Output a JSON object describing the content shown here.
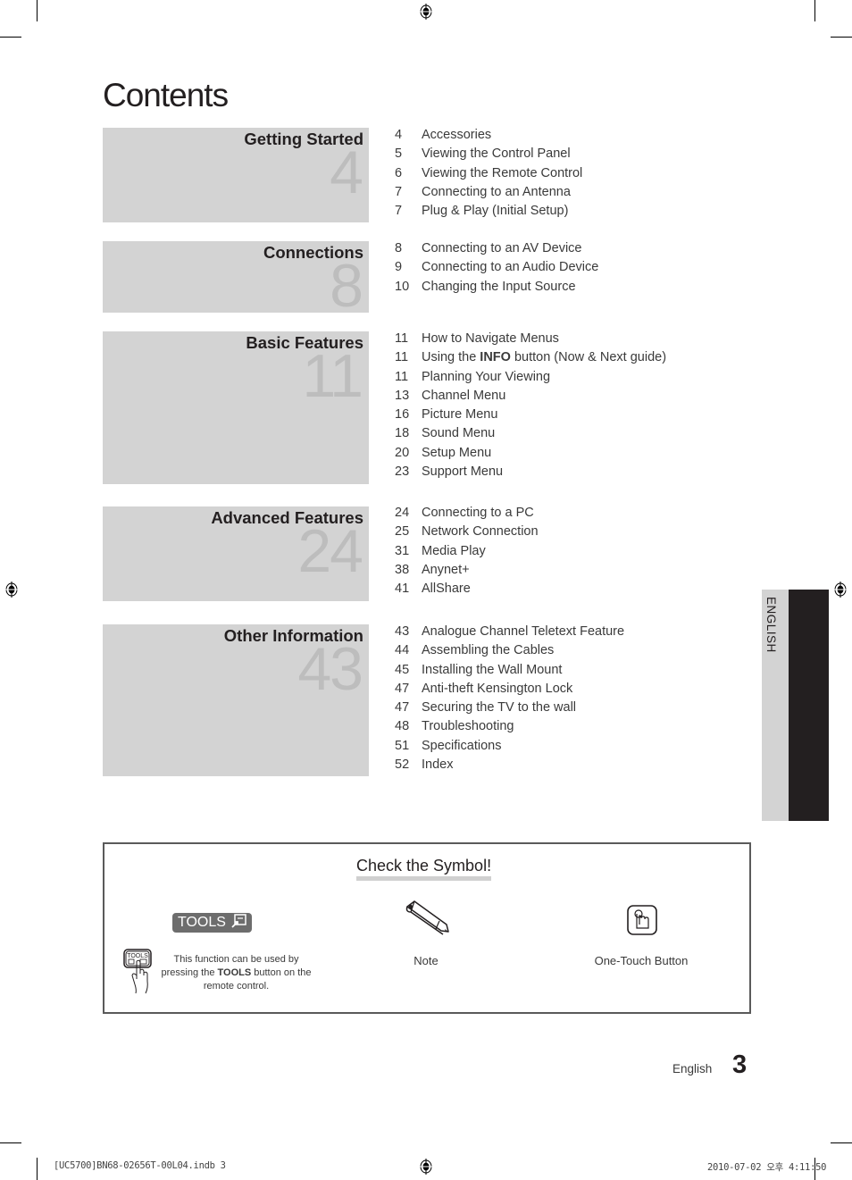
{
  "page": {
    "title": "Contents",
    "language_tab": "ENGLISH",
    "footer_language": "English",
    "page_number": "3",
    "slug_left": "[UC5700]BN68-02656T-00L04.indb   3",
    "slug_right": "2010-07-02   오후 4:11:50"
  },
  "sections": [
    {
      "name": "Getting Started",
      "start_page": "4",
      "items": [
        {
          "page": "4",
          "label": "Accessories"
        },
        {
          "page": "5",
          "label": "Viewing the Control Panel"
        },
        {
          "page": "6",
          "label": "Viewing the Remote Control"
        },
        {
          "page": "7",
          "label": "Connecting to an Antenna"
        },
        {
          "page": "7",
          "label": "Plug & Play (Initial Setup)"
        }
      ]
    },
    {
      "name": "Connections",
      "start_page": "8",
      "items": [
        {
          "page": "8",
          "label": "Connecting to an AV Device"
        },
        {
          "page": "9",
          "label": "Connecting to an Audio Device"
        },
        {
          "page": "10",
          "label": "Changing the Input Source"
        }
      ]
    },
    {
      "name": "Basic Features",
      "start_page": "11",
      "items": [
        {
          "page": "11",
          "label": "How to Navigate Menus"
        },
        {
          "page": "11",
          "label_pre": "Using the ",
          "label_bold": "INFO",
          "label_post": " button (Now & Next guide)"
        },
        {
          "page": "11",
          "label": "Planning Your Viewing"
        },
        {
          "page": "13",
          "label": "Channel Menu"
        },
        {
          "page": "16",
          "label": "Picture Menu"
        },
        {
          "page": "18",
          "label": "Sound Menu"
        },
        {
          "page": "20",
          "label": "Setup Menu"
        },
        {
          "page": "23",
          "label": "Support Menu"
        }
      ]
    },
    {
      "name": "Advanced Features",
      "start_page": "24",
      "items": [
        {
          "page": "24",
          "label": "Connecting to a PC"
        },
        {
          "page": "25",
          "label": "Network Connection"
        },
        {
          "page": "31",
          "label": "Media Play"
        },
        {
          "page": "38",
          "label": "Anynet+"
        },
        {
          "page": "41",
          "label": "AllShare"
        }
      ]
    },
    {
      "name": "Other Information",
      "start_page": "43",
      "items": [
        {
          "page": "43",
          "label": "Analogue Channel Teletext Feature"
        },
        {
          "page": "44",
          "label": "Assembling the Cables"
        },
        {
          "page": "45",
          "label": "Installing the Wall Mount"
        },
        {
          "page": "47",
          "label": "Anti-theft Kensington Lock"
        },
        {
          "page": "47",
          "label": "Securing the TV to the wall"
        },
        {
          "page": "48",
          "label": "Troubleshooting"
        },
        {
          "page": "51",
          "label": "Specifications"
        },
        {
          "page": "52",
          "label": "Index"
        }
      ]
    }
  ],
  "symbols": {
    "title": "Check the Symbol!",
    "tools": {
      "badge": "TOOLS",
      "mini_button": "TOOLS",
      "desc_pre": "This function can be used by pressing the ",
      "desc_bold": "TOOLS",
      "desc_post": " button on the remote control.",
      "icon": "tools-remote-hand-icon"
    },
    "note": {
      "label": "Note",
      "icon": "pencil-icon"
    },
    "one_touch": {
      "label": "One-Touch Button",
      "icon": "touch-button-icon"
    }
  }
}
